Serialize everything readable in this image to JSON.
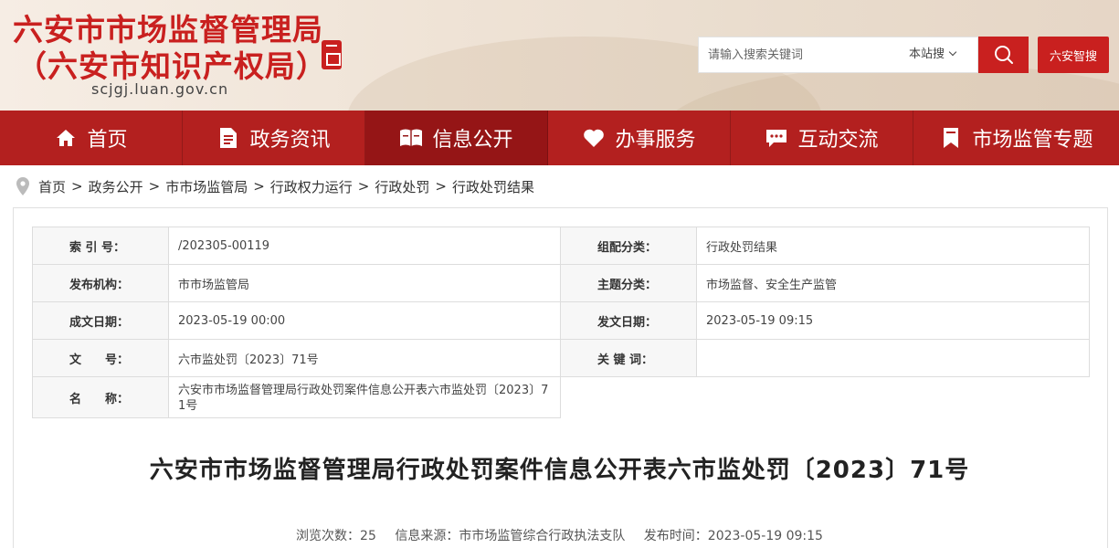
{
  "header": {
    "title_line1": "六安市市场监督管理局",
    "title_line2": "（六安市知识产权局）",
    "domain": "scjgj.luan.gov.cn",
    "search_placeholder": "请输入搜索关键词",
    "search_scope": "本站搜",
    "smart_button": "六安智搜",
    "accent_color": "#c9201f"
  },
  "nav": {
    "items": [
      {
        "label": "首页",
        "icon": "home-icon"
      },
      {
        "label": "政务资讯",
        "icon": "document-icon"
      },
      {
        "label": "信息公开",
        "icon": "open-book-icon",
        "active": true
      },
      {
        "label": "办事服务",
        "icon": "heart-icon"
      },
      {
        "label": "互动交流",
        "icon": "chat-icon"
      },
      {
        "label": "市场监管专题",
        "icon": "bookmark-icon"
      }
    ],
    "bg_color": "#b3201f",
    "active_color": "#951516"
  },
  "breadcrumb": {
    "items": [
      "首页",
      "政务公开",
      "市市场监管局",
      "行政权力运行",
      "行政处罚",
      "行政处罚结果"
    ],
    "separator": ">"
  },
  "meta": {
    "index_label": "索 引 号：",
    "index_value": "/202305-00119",
    "category_label": "组配分类：",
    "category_value": "行政处罚结果",
    "publisher_label": "发布机构：",
    "publisher_value": "市市场监管局",
    "topic_label": "主题分类：",
    "topic_value": "市场监督、安全生产监管",
    "created_label": "成文日期：",
    "created_value": "2023-05-19 00:00",
    "published_label": "发文日期：",
    "published_value": "2023-05-19 09:15",
    "docno_label": "文　　号：",
    "docno_value": "六市监处罚〔2023〕71号",
    "keywords_label": "关 键 词：",
    "keywords_value": "",
    "name_label": "名　　称：",
    "name_value": "六安市市场监督管理局行政处罚案件信息公开表六市监处罚〔2023〕71号"
  },
  "article": {
    "title": "六安市市场监督管理局行政处罚案件信息公开表六市监处罚〔2023〕71号",
    "views": "浏览次数：25",
    "source": "信息来源：市市场监管综合行政执法支队",
    "time": "发布时间：2023-05-19 09:15"
  }
}
